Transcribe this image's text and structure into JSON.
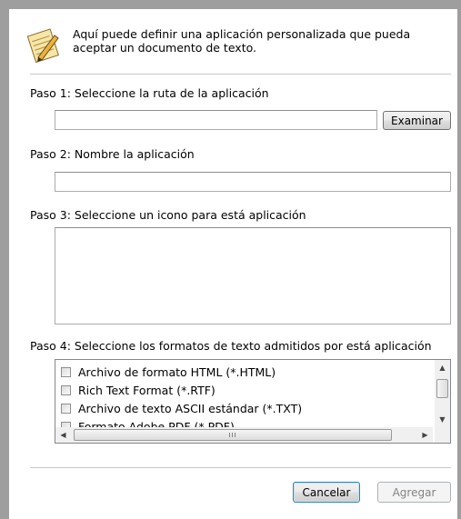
{
  "header": {
    "text": "Aquí puede definir una aplicación personalizada que pueda aceptar un documento de texto.",
    "icon": "notepad-pencil-icon"
  },
  "step1": {
    "label": "Paso 1: Seleccione la ruta de la aplicación",
    "path_value": "",
    "browse_button": "Examinar"
  },
  "step2": {
    "label": "Paso 2: Nombre la aplicación",
    "name_value": ""
  },
  "step3": {
    "label": "Paso 3: Seleccione un icono para está aplicación"
  },
  "step4": {
    "label": "Paso 4: Seleccione los formatos de texto admitidos por está aplicación",
    "formats": [
      {
        "label": "Archivo de formato HTML (*.HTML)",
        "checked": false
      },
      {
        "label": "Rich Text Format (*.RTF)",
        "checked": false
      },
      {
        "label": "Archivo de texto ASCII estándar (*.TXT)",
        "checked": false
      },
      {
        "label": "Formato Adobe PDF (*.PDF)",
        "checked": false
      }
    ],
    "hscroll_grip": "III"
  },
  "buttons": {
    "cancel": "Cancelar",
    "add": "Agregar"
  },
  "colors": {
    "frame": "#9e9e9e",
    "separator": "#c8c8c8",
    "primary_border": "#3c7fb1"
  }
}
